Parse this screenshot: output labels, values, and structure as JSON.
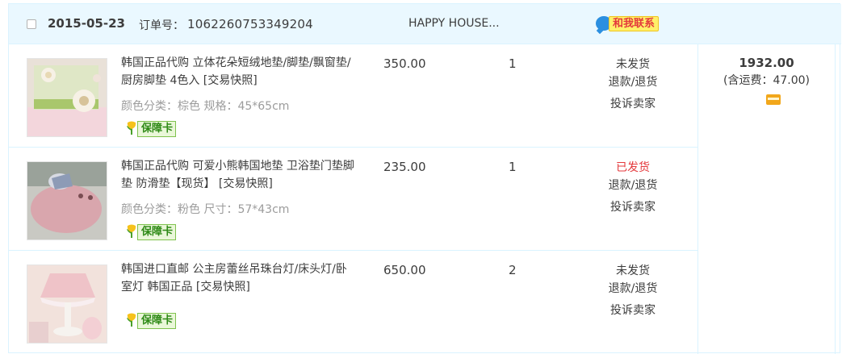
{
  "header": {
    "date": "2015-05-23",
    "order_label": "订单号：",
    "order_no": "1062260753349204",
    "shop": "HAPPY HOUSE...",
    "contact": "和我联系"
  },
  "items": [
    {
      "title": "韩国正品代购 立体花朵短绒地垫/脚垫/飘窗垫/厨房脚垫 4色入 [交易快照]",
      "sku": "颜色分类：棕色  规格：45*65cm",
      "badge": "保障卡",
      "price": "350.00",
      "qty": "1",
      "status": "未发货",
      "refund": "退款/退货",
      "complain": "投诉卖家"
    },
    {
      "title": "韩国正品代购 可爱小熊韩国地垫 卫浴垫门垫脚垫 防滑垫【现货】 [交易快照]",
      "sku": "颜色分类：粉色  尺寸：57*43cm",
      "badge": "保障卡",
      "price": "235.00",
      "qty": "1",
      "status": "已发货",
      "refund": "退款/退货",
      "complain": "投诉卖家"
    },
    {
      "title": "韩国进口直邮 公主房蕾丝吊珠台灯/床头灯/卧室灯 韩国正品 [交易快照]",
      "sku": "",
      "badge": "保障卡",
      "price": "650.00",
      "qty": "2",
      "status": "未发货",
      "refund": "退款/退货",
      "complain": "投诉卖家"
    }
  ],
  "total": {
    "amount": "1932.00",
    "shipping": "(含运费：47.00)"
  },
  "colors": {
    "header_bg": "#eaf8ff",
    "border": "#daf3ff",
    "shipped_status": "#e4393c",
    "badge_green": "#2e8a16"
  }
}
